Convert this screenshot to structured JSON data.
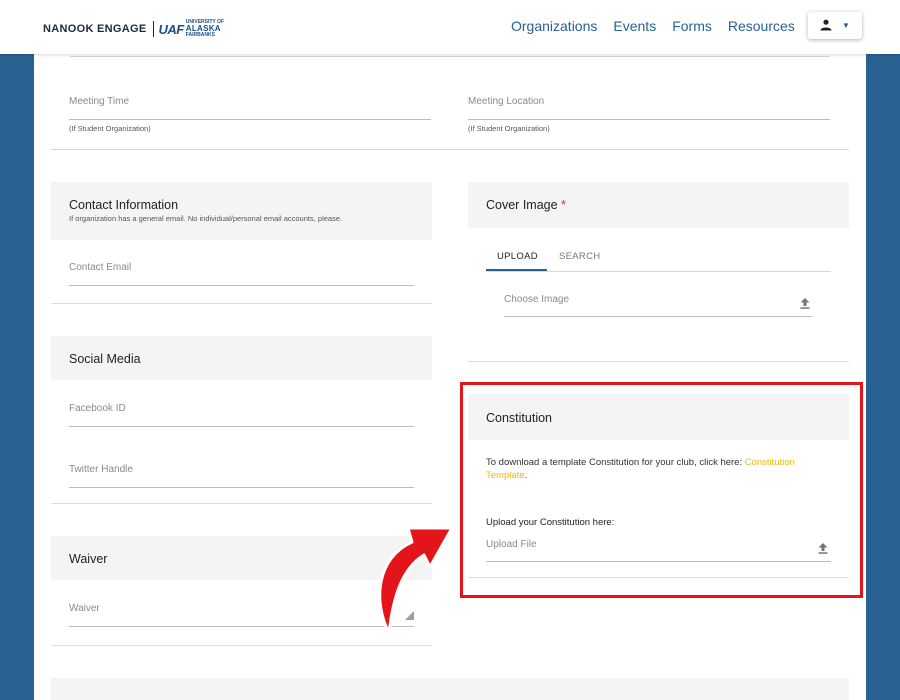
{
  "header": {
    "brand": "NANOOK ENGAGE",
    "logo": {
      "mark": "UAF",
      "sub_top": "UNIVERSITY OF",
      "sub_main": "ALASKA",
      "sub_bottom": "FAIRBANKS"
    },
    "nav": [
      "Organizations",
      "Events",
      "Forms",
      "Resources"
    ],
    "user_icon": "person-icon"
  },
  "meeting": {
    "time_label": "Meeting Time",
    "time_hint": "(If Student Organization)",
    "location_label": "Meeting Location",
    "location_hint": "(If Student Organization)"
  },
  "contact": {
    "title": "Contact Information",
    "subtitle": "If organization has a general email. No individual/personal email accounts, please.",
    "email_label": "Contact Email"
  },
  "social": {
    "title": "Social Media",
    "facebook_label": "Facebook ID",
    "twitter_label": "Twitter Handle"
  },
  "waiver": {
    "title": "Waiver",
    "field_label": "Waiver"
  },
  "cover": {
    "title": "Cover Image",
    "required_mark": "*",
    "tabs": [
      "UPLOAD",
      "SEARCH"
    ],
    "active_tab": "UPLOAD",
    "choose_label": "Choose Image"
  },
  "constitution": {
    "title": "Constitution",
    "text": "To download a template Constitution for your club, click here:",
    "link_text": "Constitution Template",
    "after_link": ".",
    "upload_heading": "Upload your Constitution here:",
    "upload_label": "Upload File"
  },
  "colors": {
    "brand_blue": "#2a6193",
    "highlight_red": "#e4141b",
    "link_gold": "#f2b705",
    "required_red": "#d32f2f"
  }
}
